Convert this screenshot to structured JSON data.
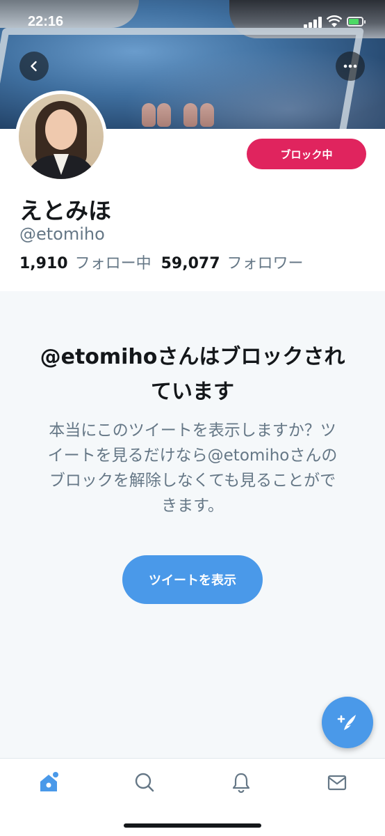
{
  "status_bar": {
    "time": "22:16"
  },
  "header": {
    "back_icon": "chevron-left-icon",
    "more_icon": "ellipsis-icon"
  },
  "profile": {
    "display_name": "えとみほ",
    "handle": "@etomiho",
    "following_count": "1,910",
    "following_label": "フォロー中",
    "followers_count": "59,077",
    "followers_label": "フォロワー",
    "blocked_button_label": "ブロック中",
    "blocked_button_color": "#e0245e"
  },
  "blocked_notice": {
    "title": "@etomihoさんはブロックされています",
    "body": "本当にこのツイートを表示しますか？ツイートを見るだけなら@etomihoさんのブロックを解除しなくても見ることができます。",
    "view_button_label": "ツイートを表示"
  },
  "fab": {
    "icon": "compose-tweet-icon"
  },
  "tab_bar": {
    "tabs": [
      {
        "name": "home",
        "icon": "home-icon",
        "active": true
      },
      {
        "name": "search",
        "icon": "search-icon",
        "active": false
      },
      {
        "name": "notifications",
        "icon": "bell-icon",
        "active": false
      },
      {
        "name": "messages",
        "icon": "mail-icon",
        "active": false
      }
    ]
  },
  "colors": {
    "accent": "#4a99e9",
    "text_primary": "#14171a",
    "text_secondary": "#657786",
    "panel_background": "#f5f8fa"
  }
}
